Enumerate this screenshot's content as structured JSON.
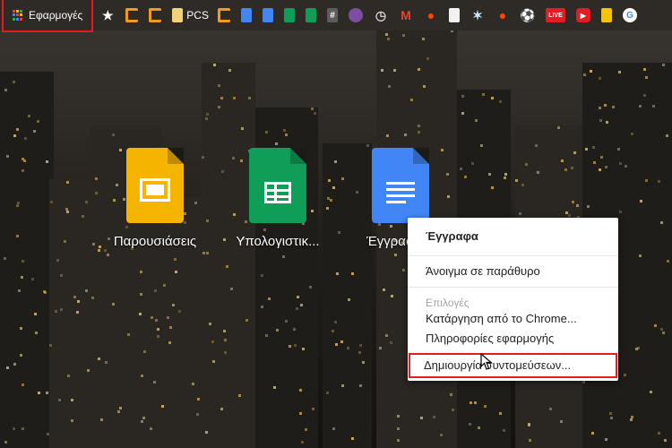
{
  "bookmarks_bar": {
    "apps_label": "Εφαρμογές",
    "apps_grid_colors": [
      "#e84335",
      "#fbbc05",
      "#34a853",
      "#4285f4",
      "#e84335",
      "#fbbc05",
      "#34a853",
      "#4285f4",
      "#e84335"
    ],
    "items": [
      {
        "icon": "star-icon",
        "color": "#ffffff",
        "glyph": "★"
      },
      {
        "icon": "bracket-icon",
        "color": "#f29b1b",
        "glyph": ""
      },
      {
        "icon": "bracket-icon",
        "color": "#f29b1b",
        "glyph": ""
      },
      {
        "icon": "folder-icon",
        "color": "#f4d27a",
        "glyph": ""
      },
      {
        "icon": "pcs-text",
        "color": "",
        "glyph": "",
        "text": "PCS"
      },
      {
        "icon": "bracket-icon",
        "color": "#f29b1b",
        "glyph": ""
      },
      {
        "icon": "docs-icon",
        "color": "#4285f4",
        "glyph": ""
      },
      {
        "icon": "docs-icon",
        "color": "#4285f4",
        "glyph": ""
      },
      {
        "icon": "sheets-icon",
        "color": "#0f9d58",
        "glyph": ""
      },
      {
        "icon": "sheets-icon",
        "color": "#0f9d58",
        "glyph": ""
      },
      {
        "icon": "hash-icon",
        "color": "#5e5e5e",
        "glyph": "#"
      },
      {
        "icon": "extension-icon",
        "color": "#7b4fa0",
        "glyph": ""
      },
      {
        "icon": "history-icon",
        "color": "#cfcfcf",
        "glyph": "◷"
      },
      {
        "icon": "gmail-icon",
        "color": "#ea4335",
        "glyph": "M"
      },
      {
        "icon": "reddit-icon",
        "color": "#ff4500",
        "glyph": "●"
      },
      {
        "icon": "document-icon",
        "color": "#f2f2f2",
        "glyph": ""
      },
      {
        "icon": "runner-icon",
        "color": "#cfe6ff",
        "glyph": "✶"
      },
      {
        "icon": "reddit-icon",
        "color": "#ff4500",
        "glyph": "●"
      },
      {
        "icon": "soccer-ball-icon",
        "color": "#ffffff",
        "glyph": "⚽"
      },
      {
        "icon": "live-icon",
        "color": "#e31c23",
        "glyph": "",
        "text": "LIVE"
      },
      {
        "icon": "youtube-icon",
        "color": "#e31c23",
        "glyph": "▶"
      },
      {
        "icon": "lightbulb-icon",
        "color": "#f5c400",
        "glyph": ""
      },
      {
        "icon": "google-icon",
        "color": "#ffffff",
        "glyph": "G"
      }
    ]
  },
  "apps": [
    {
      "name": "Παρουσιάσεις",
      "icon": "slides-icon",
      "color": "#f4b400"
    },
    {
      "name": "Υπολογιστικ...",
      "icon": "sheets-icon",
      "color": "#0f9d58"
    },
    {
      "name": "Έγγραφα",
      "icon": "docs-icon",
      "color": "#4285f4"
    }
  ],
  "context_menu": {
    "title": "Έγγραφα",
    "open_in_window": "Άνοιγμα σε παράθυρο",
    "options_header": "Επιλογές",
    "remove_from_chrome": "Κατάργηση από το Chrome...",
    "app_info": "Πληροφορίες εφαρμογής",
    "create_shortcuts": "Δημιουργία συντομεύσεων..."
  }
}
